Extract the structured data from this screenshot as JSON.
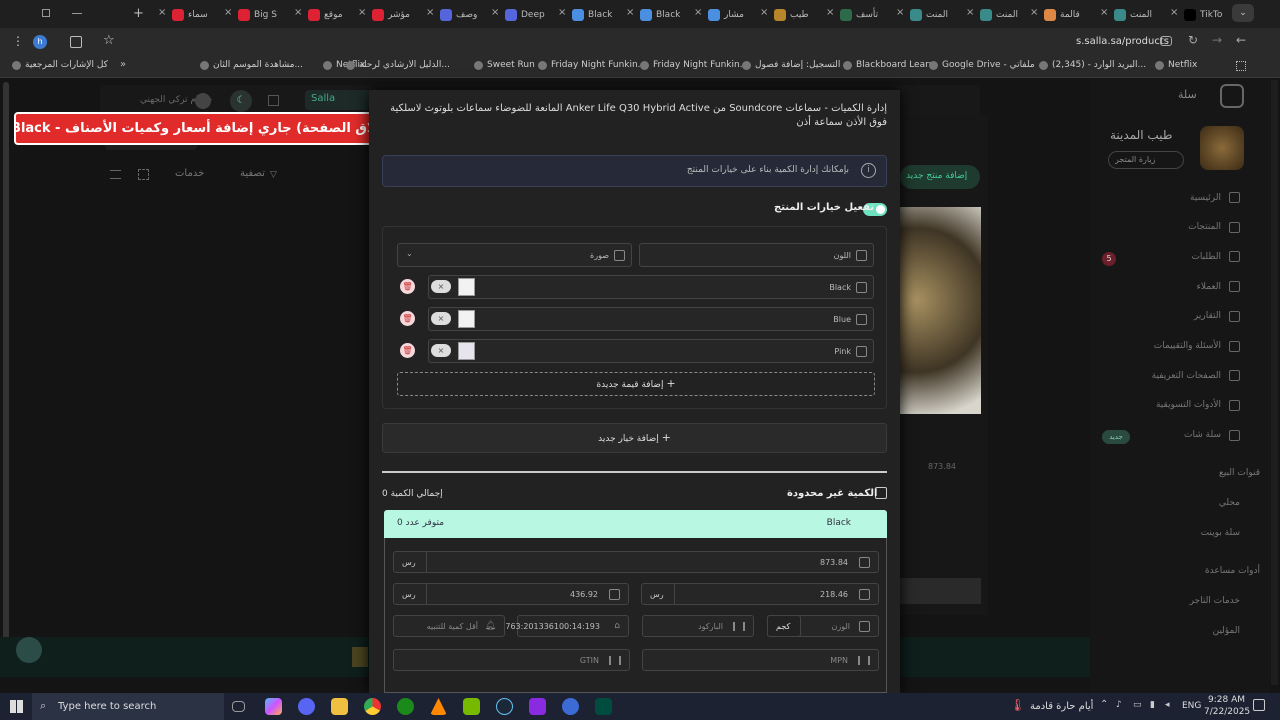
{
  "tabs": [
    {
      "label": "سماء",
      "color": "#d23"
    },
    {
      "label": "Big S",
      "color": "#d23"
    },
    {
      "label": "موقع",
      "color": "#d23"
    },
    {
      "label": "مؤشر",
      "color": "#d23"
    },
    {
      "label": "وصف",
      "color": "#5566dd"
    },
    {
      "label": "Deep",
      "color": "#5566dd"
    },
    {
      "label": "Black",
      "color": "#4a8fe0"
    },
    {
      "label": "Black",
      "color": "#4a8fe0"
    },
    {
      "label": "مشار",
      "color": "#4a8fe0"
    },
    {
      "label": "طيب",
      "color": "#b8862a"
    },
    {
      "label": "تأسف",
      "color": "#2d6a4a"
    },
    {
      "label": "المنت",
      "color": "#3a8a8a"
    },
    {
      "label": "المنت",
      "color": "#3a8a8a"
    },
    {
      "label": "قالمة",
      "color": "#d84"
    },
    {
      "label": "المنت",
      "color": "#3a8a8a"
    },
    {
      "label": "TikTo",
      "color": "#000"
    }
  ],
  "address": "s.salla.sa/products",
  "bookmarks": [
    "كل الإشارات المرجعية",
    "مشاهدة الموسم الثان...",
    "Netflix",
    "الدليل الارشادي لرحلة...",
    "Sweet Run",
    "Friday Night Funkin...",
    "Friday Night Funkin...",
    "التسجيل: إضافة فصول",
    "Blackboard Learn",
    "Google Drive - ملفاتي",
    "البريد الوارد - (2,345)...",
    "Netflix"
  ],
  "store": {
    "name": "طيب المدينة",
    "visit": "زيارة المتجر",
    "user": "حسام تركي الجهني",
    "badge": "5",
    "sallashat_badge": "جديد"
  },
  "nav": [
    "الرئيسية",
    "المنتجات",
    "الطلبات",
    "العملاء",
    "التقارير",
    "الأسئلة والتقييمات",
    "الصفحات التعريفية",
    "الأدوات التسويقية",
    "سلة شات"
  ],
  "nav_sections": [
    "قنوات البيع",
    "محلي",
    "سلة بوينت",
    "أدوات مساعدة",
    "خدمات التاجر",
    "المؤلين"
  ],
  "bg": {
    "add_product": "إضافة منتج جديد",
    "filter": "تصفية",
    "services": "خدمات",
    "home": "الرئيسية",
    "price1": "873.84"
  },
  "banner": "(نرجوا عدم إغلاق الصفحة) جاري إضافة أسعار وكميات الأصناف - Black",
  "modal": {
    "title": "إدارة الكميات - سماعات Soundcore من Anker Life Q30 Hybrid Active المانعة للضوضاء سماعات بلوتوث لاسلكية فوق الأذن سماعة أذن",
    "info": "بإمكانك إدارة الكمية بناء على خيارات المنتج",
    "enable_options": "تفعيل خيارات المنتج",
    "option_name": "اللون",
    "option_type": "صورة",
    "values": [
      "Black",
      "Blue",
      "Pink"
    ],
    "add_value": "إضافة قيمة جديدة",
    "add_option": "إضافة خيار جديد",
    "unlimited": "الكمية غير محدودة",
    "total_qty": "إجمالي الكمية 0",
    "variant": "Black",
    "available": "متوفر عدد 0",
    "currency": "رس",
    "price": "873.84",
    "cost": "218.46",
    "sale": "436.92",
    "weight": "الوزن",
    "weight_unit": "كجم",
    "barcode": "الباركود",
    "sku": "763:201336100:14:193",
    "min_notify": "أقل كمية للتنبيه",
    "mpn": "MPN",
    "gtin": "GTIN"
  },
  "taskbar": {
    "search": "Type here to search",
    "weather": "أيام حارة قادمة",
    "lang": "ENG",
    "time": "9:28 AM",
    "date": "7/22/2025"
  }
}
